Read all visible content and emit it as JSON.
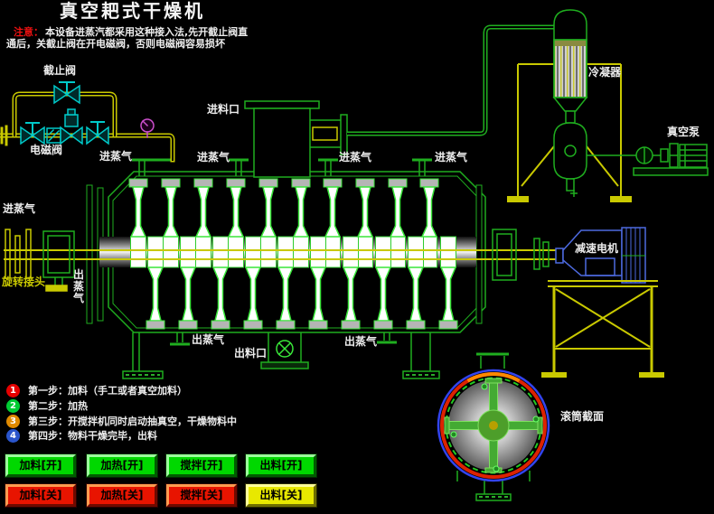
{
  "title": "真空耙式干燥机",
  "notice": {
    "prefix": "注意：",
    "line1": "本设备进蒸汽都采用这种接入法,先开截止阀直",
    "line2": "通后，关截止阀在开电磁阀，否则电磁阀容易损坏"
  },
  "labels": {
    "stop_valve": "截止阀",
    "solenoid_valve": "电磁阀",
    "steam_in": "进蒸气",
    "steam_out": "出蒸气",
    "feed_inlet": "进料口",
    "discharge_port": "出料口",
    "rotary_joint": "旋转接头",
    "condenser": "冷凝器",
    "vacuum_pump": "真空泵",
    "gear_motor": "减速电机",
    "drum_section": "滚筒截面"
  },
  "steps": [
    {
      "num": "1",
      "color": "#e60000",
      "text": "第一步：加料（手工或者真空加料）"
    },
    {
      "num": "2",
      "color": "#00cc33",
      "text": "第二步：加热"
    },
    {
      "num": "3",
      "color": "#e08a00",
      "text": "第三步：开搅拌机同时启动抽真空，干燥物料中"
    },
    {
      "num": "4",
      "color": "#2a55cc",
      "text": "第四步：物料干燥完毕，出料"
    }
  ],
  "buttons": {
    "on": [
      {
        "label": "加料[开]"
      },
      {
        "label": "加热[开]"
      },
      {
        "label": "搅拌[开]"
      },
      {
        "label": "出料[开]"
      }
    ],
    "off": [
      {
        "label": "加料[关]"
      },
      {
        "label": "加热[关]"
      },
      {
        "label": "搅拌[关]"
      },
      {
        "label": "出料[关]",
        "variant": "yellow"
      }
    ]
  },
  "colors": {
    "background": "#000000",
    "pipe_yellow": "#c9c900",
    "equipment_green": "#1fae1f",
    "paddle_green": "#39e639",
    "valve_cyan": "#00c9c9",
    "motor_blue": "#4d6ae0",
    "gauge_magenta": "#cc4fcc",
    "alert_red": "#ee1111",
    "section_ring_red": "#dd2200",
    "section_ring_blue": "#3344ee",
    "button_green": "#00d800",
    "button_red": "#e81400",
    "button_yellow": "#e8e800"
  }
}
